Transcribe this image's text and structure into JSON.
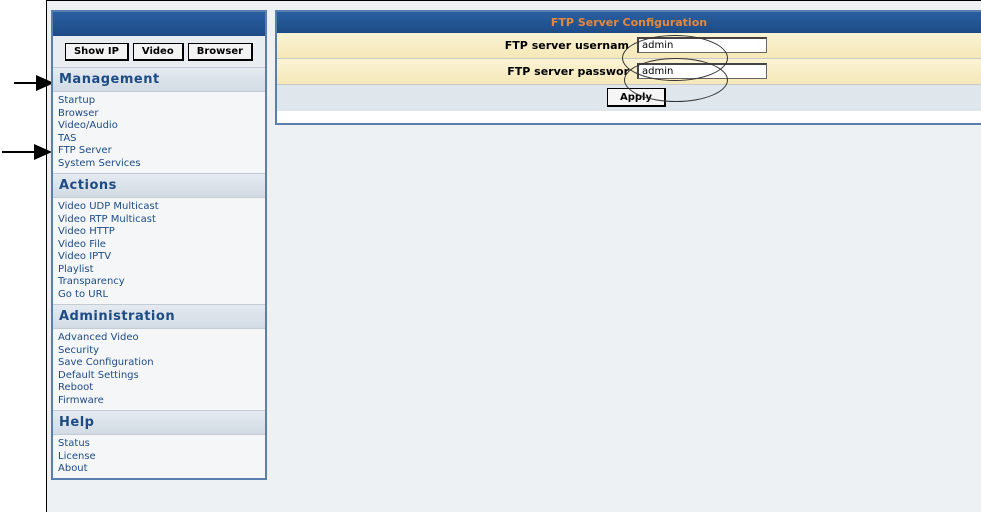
{
  "sidebar": {
    "buttons": [
      "Show IP",
      "Video",
      "Browser"
    ],
    "sections": [
      {
        "title": "Management",
        "items": [
          "Startup",
          "Browser",
          "Video/Audio",
          "TAS",
          "FTP Server",
          "System Services"
        ]
      },
      {
        "title": "Actions",
        "items": [
          "Video UDP Multicast",
          "Video RTP Multicast",
          "Video HTTP",
          "Video File",
          "Video IPTV",
          "Playlist",
          "Transparency",
          "Go to URL"
        ]
      },
      {
        "title": "Administration",
        "items": [
          "Advanced Video",
          "Security",
          "Save Configuration",
          "Default Settings",
          "Reboot",
          "Firmware"
        ]
      },
      {
        "title": "Help",
        "items": [
          "Status",
          "License",
          "About"
        ]
      }
    ]
  },
  "panel": {
    "title": "FTP Server Configuration",
    "username_label": "FTP server usernam",
    "username_value": "admin",
    "password_label": "FTP server passwor",
    "password_value": "admin",
    "apply_label": "Apply"
  },
  "colors": {
    "header_blue": "#1d4b86",
    "title_orange": "#e8873a",
    "row_yellow": "#f5e8b8"
  }
}
